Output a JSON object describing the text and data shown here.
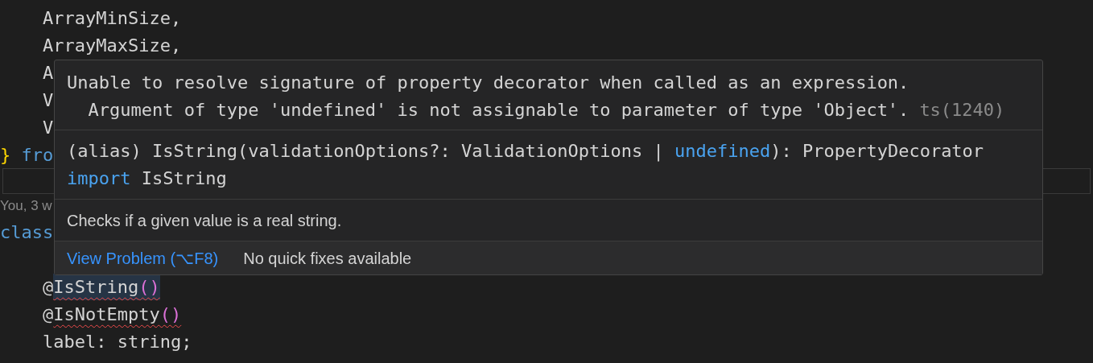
{
  "editor": {
    "lines": [
      {
        "kind": "code",
        "indent": true,
        "tokens": [
          {
            "text": "ArrayMinSize,",
            "kind": "plain"
          }
        ]
      },
      {
        "kind": "code",
        "indent": true,
        "tokens": [
          {
            "text": "ArrayMaxSize,",
            "kind": "plain"
          }
        ]
      },
      {
        "kind": "code",
        "indent": true,
        "tokens": [
          {
            "text": "A",
            "kind": "plain"
          }
        ]
      },
      {
        "kind": "code",
        "indent": true,
        "tokens": [
          {
            "text": "V",
            "kind": "plain"
          }
        ]
      },
      {
        "kind": "code",
        "indent": true,
        "tokens": [
          {
            "text": "V",
            "kind": "plain"
          }
        ]
      },
      {
        "kind": "code",
        "indent": false,
        "tokens": [
          {
            "text": "}",
            "kind": "brace"
          },
          {
            "text": " fro",
            "kind": "keyword"
          }
        ]
      },
      {
        "kind": "widget"
      },
      {
        "kind": "codelens",
        "text": "You, 3 w"
      },
      {
        "kind": "code",
        "indent": false,
        "tokens": [
          {
            "text": "class",
            "kind": "keyword"
          }
        ]
      },
      {
        "kind": "blank"
      },
      {
        "kind": "code",
        "indent": true,
        "tokens": [
          {
            "text": "@",
            "kind": "plain",
            "error": false,
            "highlighted": false
          },
          {
            "text": "IsString",
            "kind": "plain",
            "error": true,
            "highlighted": true
          },
          {
            "text": "()",
            "kind": "paren",
            "error": true,
            "highlighted": true
          }
        ]
      },
      {
        "kind": "code",
        "indent": true,
        "tokens": [
          {
            "text": "@",
            "kind": "plain",
            "error": false,
            "highlighted": false
          },
          {
            "text": "IsNotEmpty",
            "kind": "plain",
            "error": true,
            "highlighted": false
          },
          {
            "text": "()",
            "kind": "paren",
            "error": true,
            "highlighted": false
          }
        ]
      },
      {
        "kind": "code",
        "indent": true,
        "tokens": [
          {
            "text": "label: string;",
            "kind": "plain"
          }
        ]
      }
    ]
  },
  "hover": {
    "message": [
      "Unable to resolve signature of property decorator when called as an expression.",
      "  Argument of type 'undefined' is not assignable to parameter of type 'Object'."
    ],
    "error_code": "ts(1240)",
    "signature": [
      [
        {
          "text": "(alias) IsString(validationOptions?: ValidationOptions | ",
          "kind": "plain"
        },
        {
          "text": "undefined",
          "kind": "keyword"
        },
        {
          "text": "): PropertyDecorator",
          "kind": "plain"
        }
      ],
      [
        {
          "text": "import",
          "kind": "keyword"
        },
        {
          "text": " IsString",
          "kind": "plain"
        }
      ]
    ],
    "documentation": "Checks if a given value is a real string.",
    "status_bar": {
      "link": "View Problem (⌥F8)",
      "note": "No quick fixes available"
    }
  }
}
